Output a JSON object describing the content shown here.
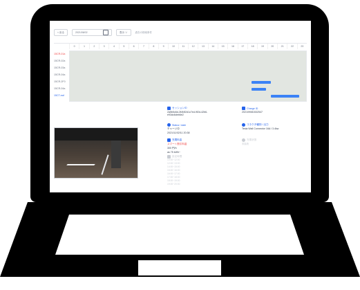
{
  "toolbar": {
    "back_label": "< 戻る",
    "date_value": "2021/06/02",
    "calendar_icon": "calendar-icon",
    "view_label": "表示 ∨",
    "extra_label": "過去の検索条件"
  },
  "schedule": {
    "hours": [
      "0",
      "1",
      "2",
      "3",
      "4",
      "5",
      "6",
      "7",
      "8",
      "9",
      "10",
      "11",
      "12",
      "13",
      "14",
      "15",
      "16",
      "17",
      "18",
      "19",
      "20",
      "21",
      "22",
      "23"
    ],
    "rows": [
      {
        "label": "15CR-01a",
        "tone": "red"
      },
      {
        "label": "15CR-02a",
        "tone": "gray"
      },
      {
        "label": "15CR-03a",
        "tone": "gray"
      },
      {
        "label": "15CR-04a",
        "tone": "gray"
      },
      {
        "label": "15CR-2F0",
        "tone": "gray"
      },
      {
        "label": "15CR-04a",
        "tone": "gray"
      },
      {
        "label": "15CT-eaf",
        "tone": "blue"
      }
    ],
    "accent_color": "#3b82f6",
    "grid_color": "#e2e6e1"
  },
  "detail": {
    "session_id_label": "セッションID",
    "session_id_value": "2a5b5c6d-3f4f4f2d1c7ed-9f2d-42b6-e93dc6deb6e2",
    "status_label": "Status / date",
    "status_value": "チャージ中",
    "status_date": "2021/11/02/11 20:38",
    "cost_label": "充電料金",
    "cost_sublabel": "スマート割引料金",
    "cost_value": "300 円/h",
    "cost_note": "as 75 kWh~",
    "faint_label": "設定時間",
    "faint_lines": [
      "10:00~12:00",
      "12:00~13:00",
      "14:00~15:00",
      "15:00~16:00",
      "16:00~17:00",
      "17:00~18:00",
      "18:00~19:00",
      "19:00~20:00"
    ],
    "charger_id_label": "Charge ID",
    "charger_id_value": "202109081532547",
    "connector_label": "コネクタ種別 / 出力",
    "connector_value": "Tesla Wall Connector 16A / 3.4kw",
    "right_faint_label": "充電状態",
    "right_faint_value": "未接続"
  }
}
